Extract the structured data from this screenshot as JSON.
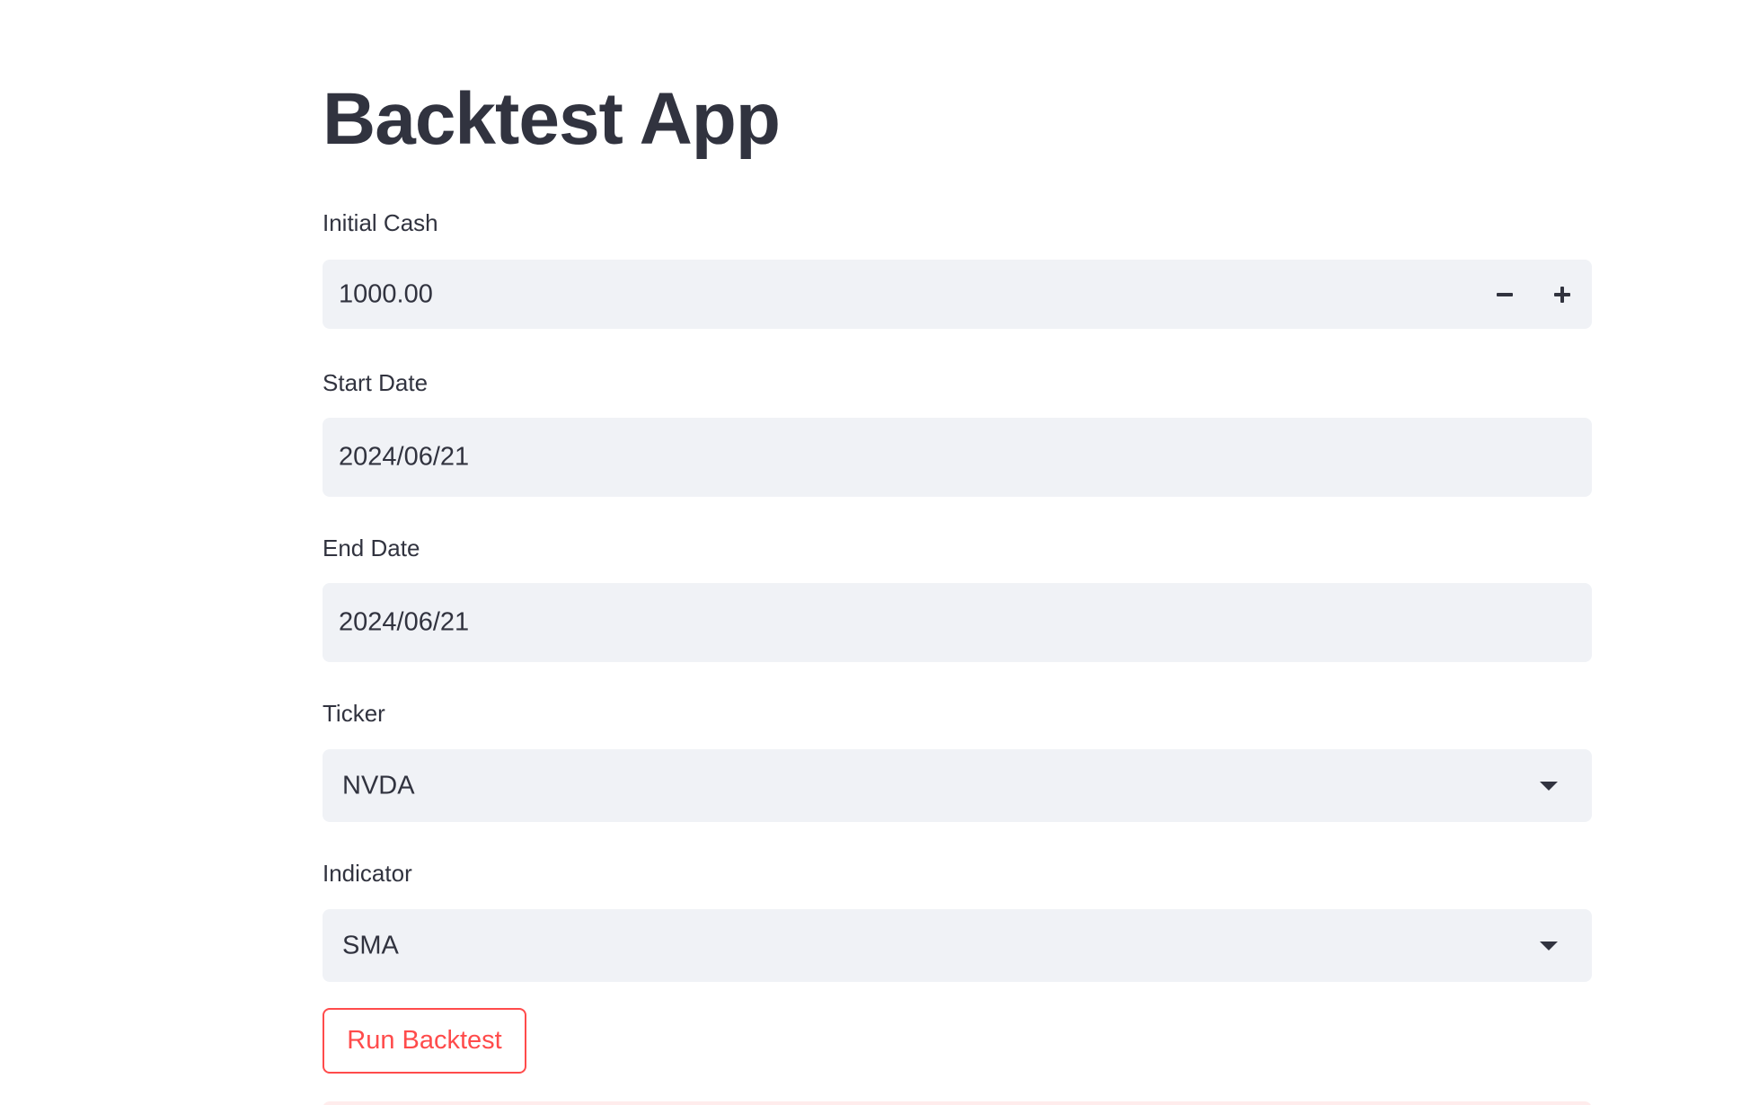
{
  "app": {
    "title": "Backtest App"
  },
  "form": {
    "initial_cash": {
      "label": "Initial Cash",
      "value": "1000.00",
      "decrement_icon": "minus-icon",
      "increment_icon": "plus-icon"
    },
    "start_date": {
      "label": "Start Date",
      "value": "2024/06/21"
    },
    "end_date": {
      "label": "End Date",
      "value": "2024/06/21"
    },
    "ticker": {
      "label": "Ticker",
      "selected": "NVDA",
      "icon": "caret-down-icon"
    },
    "indicator": {
      "label": "Indicator",
      "selected": "SMA",
      "icon": "caret-down-icon"
    },
    "run_button_label": "Run Backtest"
  },
  "colors": {
    "text": "#31333f",
    "input_background": "#f0f2f6",
    "primary": "#ff4b4b",
    "alert_background": "#ffecec"
  }
}
